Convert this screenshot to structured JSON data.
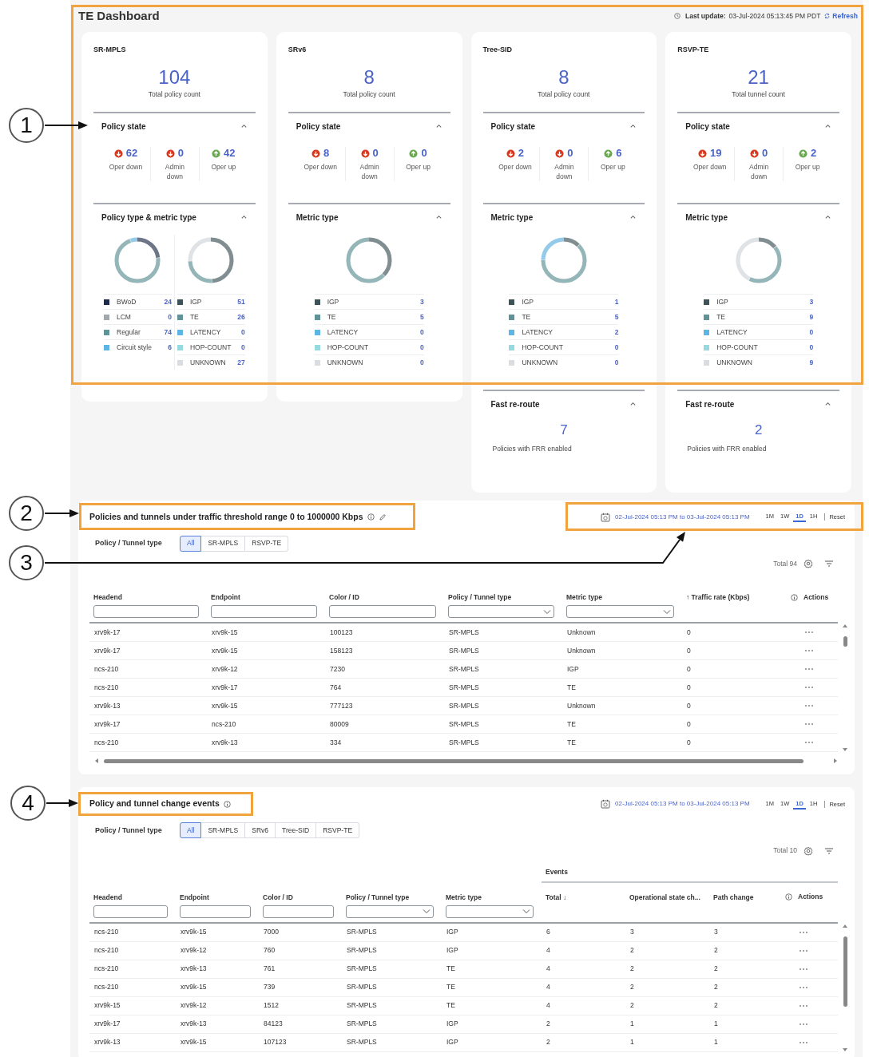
{
  "page_title": "TE Dashboard",
  "last_update": {
    "label": "Last update:",
    "value": "03-Jul-2024 05:13:45 PM PDT",
    "refresh": "Refresh"
  },
  "cards": [
    {
      "title": "SR-MPLS",
      "total": "104",
      "total_label": "Total policy count",
      "policy_state": {
        "title": "Policy state",
        "expanded": true,
        "items": [
          {
            "kind": "down",
            "count": "62",
            "label": "Oper down"
          },
          {
            "kind": "down",
            "count": "0",
            "label": "Admin down"
          },
          {
            "kind": "up",
            "count": "42",
            "label": "Oper up"
          }
        ]
      },
      "breakdown": {
        "title": "Policy type & metric type",
        "expanded": true,
        "groups": [
          {
            "items": [
              {
                "label": "BWoD",
                "value": "24",
                "color": "#1f2a48"
              },
              {
                "label": "LCM",
                "value": "0",
                "color": "#a3a8ad"
              },
              {
                "label": "Regular",
                "value": "74",
                "color": "#5f9397"
              },
              {
                "label": "Circuit style",
                "value": "6",
                "color": "#5db5e6"
              }
            ]
          },
          {
            "items": [
              {
                "label": "IGP",
                "value": "51",
                "color": "#3d5357"
              },
              {
                "label": "TE",
                "value": "26",
                "color": "#5f9397"
              },
              {
                "label": "LATENCY",
                "value": "0",
                "color": "#5db5e6"
              },
              {
                "label": "HOP-COUNT",
                "value": "0",
                "color": "#94dade"
              },
              {
                "label": "UNKNOWN",
                "value": "27",
                "color": "#d9dce0"
              }
            ]
          }
        ]
      }
    },
    {
      "title": "SRv6",
      "total": "8",
      "total_label": "Total policy count",
      "policy_state": {
        "title": "Policy state",
        "expanded": true,
        "items": [
          {
            "kind": "down",
            "count": "8",
            "label": "Oper down"
          },
          {
            "kind": "down",
            "count": "0",
            "label": "Admin down"
          },
          {
            "kind": "up",
            "count": "0",
            "label": "Oper up"
          }
        ]
      },
      "breakdown": {
        "title": "Metric type",
        "expanded": true,
        "groups": [
          {
            "items": [
              {
                "label": "IGP",
                "value": "3",
                "color": "#3d5357"
              },
              {
                "label": "TE",
                "value": "5",
                "color": "#5f9397"
              },
              {
                "label": "LATENCY",
                "value": "0",
                "color": "#5db5e6"
              },
              {
                "label": "HOP-COUNT",
                "value": "0",
                "color": "#94dade"
              },
              {
                "label": "UNKNOWN",
                "value": "0",
                "color": "#d9dce0"
              }
            ]
          }
        ]
      }
    },
    {
      "title": "Tree-SID",
      "total": "8",
      "total_label": "Total policy count",
      "policy_state": {
        "title": "Policy state",
        "expanded": true,
        "items": [
          {
            "kind": "down",
            "count": "2",
            "label": "Oper down"
          },
          {
            "kind": "down",
            "count": "0",
            "label": "Admin down"
          },
          {
            "kind": "up",
            "count": "6",
            "label": "Oper up"
          }
        ]
      },
      "breakdown": {
        "title": "Metric type",
        "expanded": true,
        "groups": [
          {
            "items": [
              {
                "label": "IGP",
                "value": "1",
                "color": "#3d5357"
              },
              {
                "label": "TE",
                "value": "5",
                "color": "#5f9397"
              },
              {
                "label": "LATENCY",
                "value": "2",
                "color": "#5db5e6"
              },
              {
                "label": "HOP-COUNT",
                "value": "0",
                "color": "#94dade"
              },
              {
                "label": "UNKNOWN",
                "value": "0",
                "color": "#d9dce0"
              }
            ]
          }
        ]
      },
      "fast_reroute": {
        "title": "Fast re-route",
        "expanded": true,
        "count": "7",
        "label": "Policies with FRR enabled"
      }
    },
    {
      "title": "RSVP-TE",
      "total": "21",
      "total_label": "Total tunnel count",
      "policy_state": {
        "title": "Policy state",
        "expanded": true,
        "items": [
          {
            "kind": "down",
            "count": "19",
            "label": "Oper down"
          },
          {
            "kind": "down",
            "count": "0",
            "label": "Admin down"
          },
          {
            "kind": "up",
            "count": "2",
            "label": "Oper up"
          }
        ]
      },
      "breakdown": {
        "title": "Metric type",
        "expanded": true,
        "groups": [
          {
            "items": [
              {
                "label": "IGP",
                "value": "3",
                "color": "#3d5357"
              },
              {
                "label": "TE",
                "value": "9",
                "color": "#5f9397"
              },
              {
                "label": "LATENCY",
                "value": "0",
                "color": "#5db5e6"
              },
              {
                "label": "HOP-COUNT",
                "value": "0",
                "color": "#94dade"
              },
              {
                "label": "UNKNOWN",
                "value": "9",
                "color": "#d9dce0"
              }
            ]
          }
        ]
      },
      "fast_reroute": {
        "title": "Fast re-route",
        "expanded": true,
        "count": "2",
        "label": "Policies with FRR enabled"
      }
    }
  ],
  "panels": [
    {
      "title": "Policies and tunnels under traffic threshold range 0 to 1000000 Kbps",
      "editable": true,
      "time_range": {
        "text": "02-Jul-2024 05:13 PM to 03-Jul-2024 05:13 PM",
        "presets": [
          {
            "label": "1M",
            "selected": false
          },
          {
            "label": "1W",
            "selected": false
          },
          {
            "label": "1D",
            "selected": true
          },
          {
            "label": "1H",
            "selected": false
          }
        ],
        "reset": "Reset"
      },
      "filter_label": "Policy / Tunnel type",
      "filters": [
        {
          "label": "All",
          "selected": true
        },
        {
          "label": "SR-MPLS",
          "selected": false
        },
        {
          "label": "RSVP-TE",
          "selected": false
        }
      ],
      "total": "Total 94",
      "table": {
        "columns": [
          {
            "label": "Headend",
            "kind": "text"
          },
          {
            "label": "Endpoint",
            "kind": "text"
          },
          {
            "label": "Color / ID",
            "kind": "text"
          },
          {
            "label": "Policy / Tunnel type",
            "kind": "select"
          },
          {
            "label": "Metric type",
            "kind": "select"
          },
          {
            "label": "↑ Traffic rate (Kbps)",
            "kind": "plain"
          },
          {
            "label": "Actions",
            "kind": "actions"
          }
        ],
        "rows": [
          [
            "xrv9k-17",
            "xrv9k-15",
            "100123",
            "SR-MPLS",
            "Unknown",
            "0"
          ],
          [
            "xrv9k-17",
            "xrv9k-15",
            "158123",
            "SR-MPLS",
            "Unknown",
            "0"
          ],
          [
            "ncs-210",
            "xrv9k-12",
            "7230",
            "SR-MPLS",
            "IGP",
            "0"
          ],
          [
            "ncs-210",
            "xrv9k-17",
            "764",
            "SR-MPLS",
            "TE",
            "0"
          ],
          [
            "xrv9k-13",
            "xrv9k-15",
            "777123",
            "SR-MPLS",
            "Unknown",
            "0"
          ],
          [
            "xrv9k-17",
            "ncs-210",
            "80009",
            "SR-MPLS",
            "TE",
            "0"
          ],
          [
            "ncs-210",
            "xrv9k-13",
            "334",
            "SR-MPLS",
            "TE",
            "0"
          ]
        ]
      }
    },
    {
      "title": "Policy and tunnel change events",
      "editable": false,
      "time_range": {
        "text": "02-Jul-2024 05:13 PM to 03-Jul-2024 05:13 PM",
        "presets": [
          {
            "label": "1M",
            "selected": false
          },
          {
            "label": "1W",
            "selected": false
          },
          {
            "label": "1D",
            "selected": true
          },
          {
            "label": "1H",
            "selected": false
          }
        ],
        "reset": "Reset"
      },
      "filter_label": "Policy / Tunnel type",
      "filters": [
        {
          "label": "All",
          "selected": true
        },
        {
          "label": "SR-MPLS",
          "selected": false
        },
        {
          "label": "SRv6",
          "selected": false
        },
        {
          "label": "Tree-SID",
          "selected": false
        },
        {
          "label": "RSVP-TE",
          "selected": false
        }
      ],
      "total": "Total 10",
      "table": {
        "group_label": "Events",
        "columns": [
          {
            "label": "Headend",
            "kind": "text"
          },
          {
            "label": "Endpoint",
            "kind": "text"
          },
          {
            "label": "Color / ID",
            "kind": "text"
          },
          {
            "label": "Policy / Tunnel type",
            "kind": "select"
          },
          {
            "label": "Metric type",
            "kind": "select"
          },
          {
            "label": "Total ↓",
            "kind": "plain",
            "grouped": true
          },
          {
            "label": "Operational state ch...",
            "kind": "plain",
            "grouped": true
          },
          {
            "label": "Path change",
            "kind": "plain",
            "grouped": true
          },
          {
            "label": "Actions",
            "kind": "actions"
          }
        ],
        "rows": [
          [
            "ncs-210",
            "xrv9k-15",
            "7000",
            "SR-MPLS",
            "IGP",
            "6",
            "3",
            "3"
          ],
          [
            "ncs-210",
            "xrv9k-12",
            "760",
            "SR-MPLS",
            "IGP",
            "4",
            "2",
            "2"
          ],
          [
            "ncs-210",
            "xrv9k-13",
            "761",
            "SR-MPLS",
            "TE",
            "4",
            "2",
            "2"
          ],
          [
            "ncs-210",
            "xrv9k-15",
            "739",
            "SR-MPLS",
            "TE",
            "4",
            "2",
            "2"
          ],
          [
            "xrv9k-15",
            "xrv9k-12",
            "1512",
            "SR-MPLS",
            "TE",
            "4",
            "2",
            "2"
          ],
          [
            "xrv9k-17",
            "xrv9k-13",
            "84123",
            "SR-MPLS",
            "IGP",
            "2",
            "1",
            "1"
          ],
          [
            "xrv9k-13",
            "xrv9k-15",
            "107123",
            "SR-MPLS",
            "IGP",
            "2",
            "1",
            "1"
          ]
        ]
      }
    }
  ],
  "callouts": [
    {
      "number": "1"
    },
    {
      "number": "2"
    },
    {
      "number": "3"
    },
    {
      "number": "4"
    }
  ]
}
